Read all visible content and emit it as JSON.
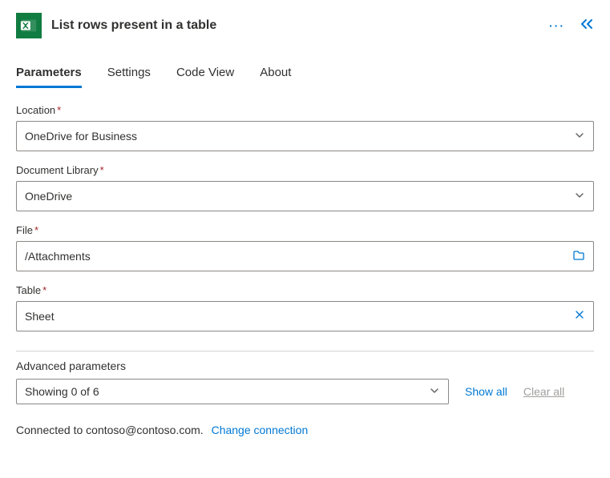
{
  "header": {
    "title": "List rows present in a table"
  },
  "tabs": {
    "parameters": "Parameters",
    "settings": "Settings",
    "codeview": "Code View",
    "about": "About"
  },
  "fields": {
    "location": {
      "label": "Location",
      "value": "OneDrive for Business"
    },
    "library": {
      "label": "Document Library",
      "value": "OneDrive"
    },
    "file": {
      "label": "File",
      "value": "/Attachments"
    },
    "table": {
      "label": "Table",
      "value": "Sheet"
    }
  },
  "advanced": {
    "label": "Advanced parameters",
    "summary": "Showing 0 of 6",
    "show_all": "Show all",
    "clear_all": "Clear all"
  },
  "footer": {
    "connected_prefix": "Connected to ",
    "account": "contoso@contoso.com.",
    "change": "Change connection"
  }
}
